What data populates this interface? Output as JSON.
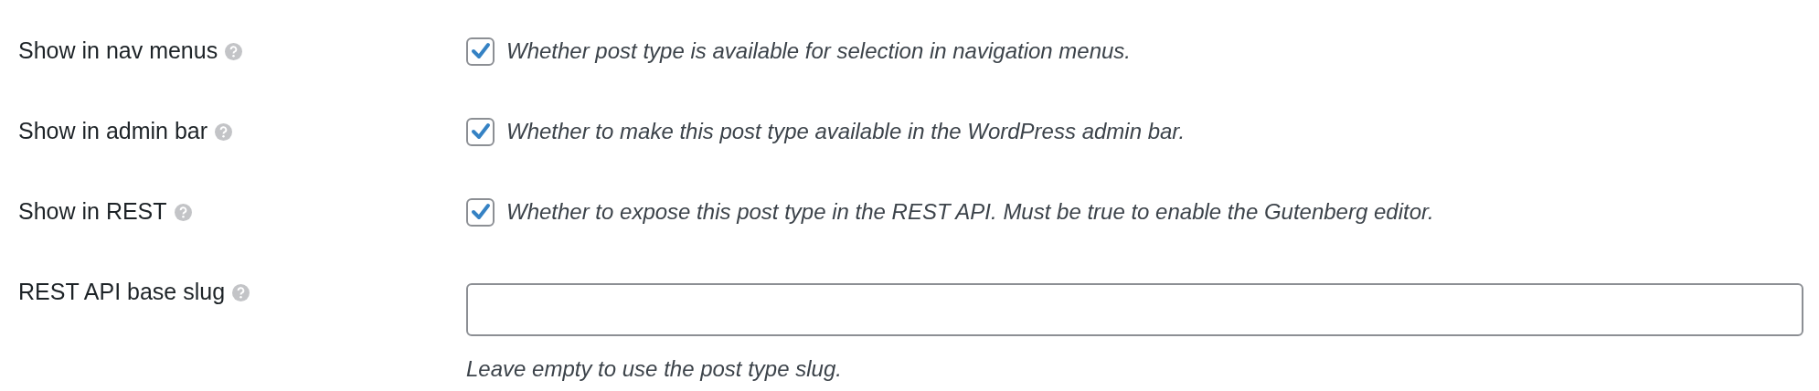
{
  "rows": [
    {
      "kind": "checkbox",
      "label": "Show in nav menus",
      "checked": true,
      "description": "Whether post type is available for selection in navigation menus."
    },
    {
      "kind": "checkbox",
      "label": "Show in admin bar",
      "checked": true,
      "description": "Whether to make this post type available in the WordPress admin bar."
    },
    {
      "kind": "checkbox",
      "label": "Show in REST",
      "checked": true,
      "description": "Whether to expose this post type in the REST API. Must be true to enable the Gutenberg editor."
    },
    {
      "kind": "text",
      "label": "REST API base slug",
      "description": "Leave empty to use the post type slug."
    }
  ]
}
